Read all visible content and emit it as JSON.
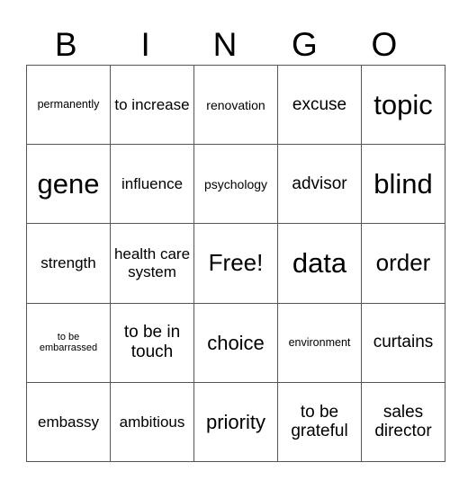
{
  "header": [
    "B",
    "I",
    "N",
    "G",
    "O"
  ],
  "rows": [
    [
      "permanently",
      "to increase",
      "renovation",
      "excuse",
      "topic"
    ],
    [
      "gene",
      "influence",
      "psychology",
      "advisor",
      "blind"
    ],
    [
      "strength",
      "health care system",
      "Free!",
      "data",
      "order"
    ],
    [
      "to be embarrassed",
      "to be in touch",
      "choice",
      "environment",
      "curtains"
    ],
    [
      "embassy",
      "ambitious",
      "priority",
      "to be grateful",
      "sales director"
    ]
  ]
}
